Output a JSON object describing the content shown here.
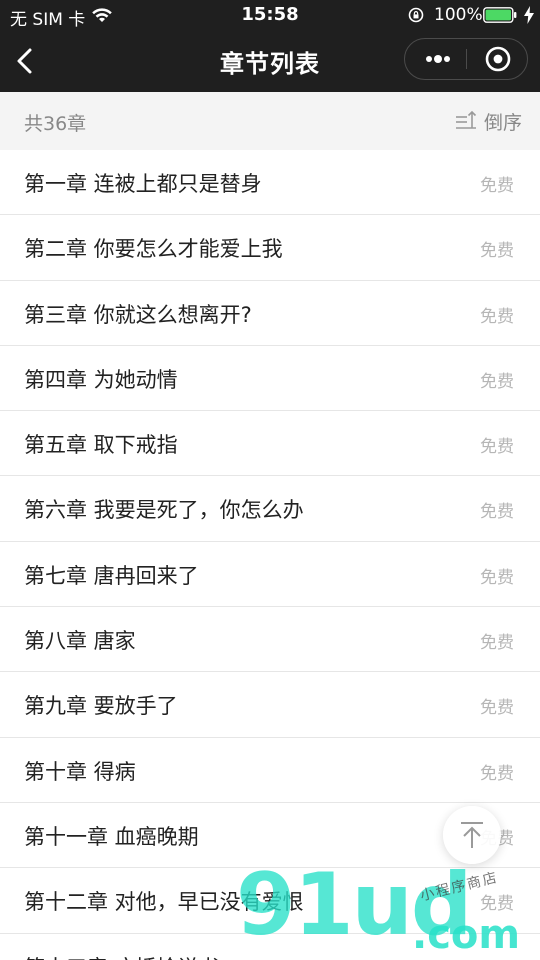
{
  "status_bar": {
    "carrier": "无 SIM 卡",
    "time": "15:58",
    "battery_percent": "100%"
  },
  "nav": {
    "title": "章节列表"
  },
  "subheader": {
    "count": "共36章",
    "sort_label": "倒序"
  },
  "chapters": [
    {
      "title": "第一章 连被上都只是替身",
      "badge": "免费"
    },
    {
      "title": "第二章 你要怎么才能爱上我",
      "badge": "免费"
    },
    {
      "title": "第三章 你就这么想离开?",
      "badge": "免费"
    },
    {
      "title": "第四章 为她动情",
      "badge": "免费"
    },
    {
      "title": "第五章 取下戒指",
      "badge": "免费"
    },
    {
      "title": "第六章 我要是死了，你怎么办",
      "badge": "免费"
    },
    {
      "title": "第七章 唐冉回来了",
      "badge": "免费"
    },
    {
      "title": "第八章 唐家",
      "badge": "免费"
    },
    {
      "title": "第九章 要放手了",
      "badge": "免费"
    },
    {
      "title": "第十章 得病",
      "badge": "免费"
    },
    {
      "title": "第十一章 血癌晚期",
      "badge": "免费"
    },
    {
      "title": "第十二章 对他，早已没有爱恨",
      "badge": "免费"
    },
    {
      "title": "第十三章 床插捡说书",
      "badge": "免费"
    }
  ],
  "watermark": {
    "big": "91ud",
    "suffix": ".com",
    "small": "小程序商店"
  },
  "colors": {
    "topbar": "#1f1f1f",
    "subheader_bg": "#f4f4f4",
    "muted_text": "#888888",
    "badge_text": "#b6b6b6",
    "watermark": "#26e0c8"
  },
  "icons": [
    "wifi-icon",
    "lock-rotation-icon",
    "battery-icon",
    "charging-bolt-icon",
    "back-chevron-icon",
    "more-dots-icon",
    "target-close-icon",
    "sort-icon",
    "arrow-up-to-top-icon"
  ]
}
